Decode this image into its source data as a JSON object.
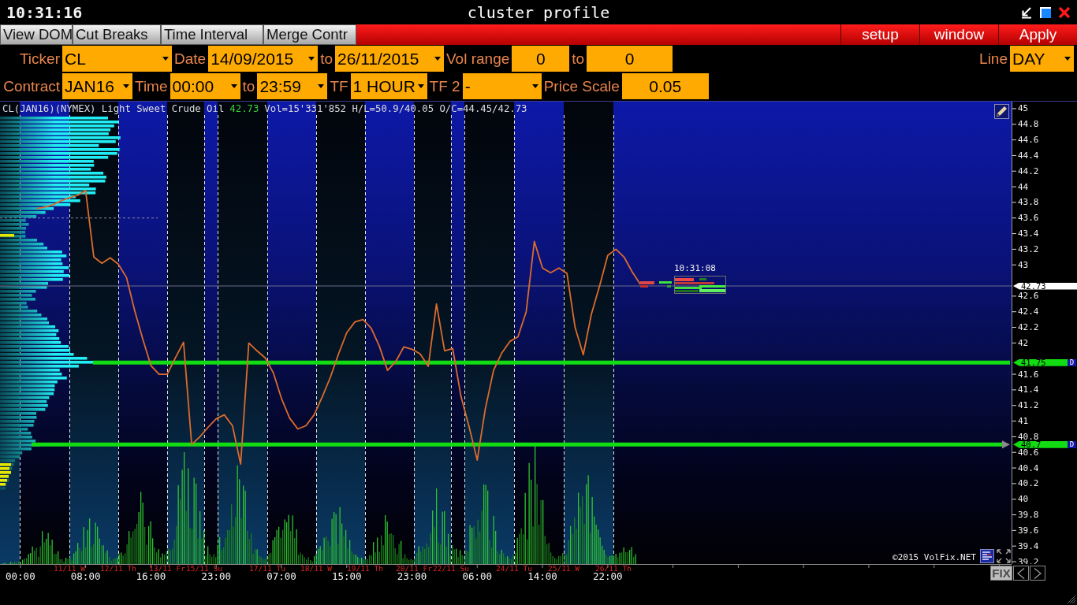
{
  "title_bar": {
    "clock": "10:31:16",
    "title": "cluster profile"
  },
  "toolbar": {
    "tools": [
      "View DOM",
      "Cut Breaks",
      "Time Interval",
      "Merge Contr"
    ],
    "menus": [
      "setup",
      "window",
      "Apply"
    ]
  },
  "parameters": [
    {
      "left": [
        {
          "label": "Ticker",
          "value": "CL",
          "kind": "dropdown"
        },
        {
          "label": "Date",
          "value": "14/09/2015",
          "kind": "dropdown"
        },
        {
          "label": "to",
          "value": "26/11/2015",
          "kind": "dropdown"
        },
        {
          "label": "Vol range",
          "value": "0",
          "kind": "number"
        },
        {
          "label": "to",
          "value": "0",
          "kind": "number"
        }
      ],
      "right": [
        {
          "label": "Line",
          "value": "DAY",
          "kind": "dropdown"
        }
      ]
    },
    {
      "left": [
        {
          "label": "Contract",
          "value": "JAN16",
          "kind": "dropdown"
        },
        {
          "label": "Time",
          "value": "00:00",
          "kind": "dropdown"
        },
        {
          "label": "to",
          "value": "23:59",
          "kind": "dropdown"
        },
        {
          "label": "TF",
          "value": "1 HOUR",
          "kind": "dropdown"
        },
        {
          "label": "TF 2",
          "value": "-",
          "kind": "dropdown"
        },
        {
          "label": "Price Scale",
          "value": "0.05",
          "kind": "number"
        }
      ]
    }
  ],
  "chart": {
    "header": {
      "instrument": "CL(JAN16)(NYMEX) Light Sweet Crude Oil",
      "last_price": "42.73",
      "stats": "Vol=15'331'852 H/L=50.9/40.05 O/C=44.45/42.73"
    },
    "chart_data": {
      "type": "line",
      "categories": [
        null,
        null,
        "00:00",
        null,
        null,
        null,
        null,
        null,
        null,
        null,
        "08:00",
        null,
        null,
        null,
        null,
        null,
        null,
        null,
        "16:00",
        null,
        null,
        null,
        null,
        null,
        null,
        null,
        "23:00",
        null,
        null,
        null,
        null,
        null,
        null,
        null,
        "07:00",
        null,
        null,
        null,
        null,
        null,
        null,
        null,
        "15:00",
        null,
        null,
        null,
        null,
        null,
        null,
        null,
        "23:00",
        null,
        null,
        null,
        null,
        null,
        null,
        null,
        "06:00",
        null,
        null,
        null,
        null,
        null,
        null,
        null,
        "14:00",
        null,
        null,
        null,
        null,
        null,
        null,
        null,
        "22:00",
        null,
        null,
        null,
        null,
        null,
        null,
        null,
        null,
        null,
        null,
        null,
        null,
        null,
        null,
        null,
        null,
        null,
        null,
        null,
        null,
        null,
        null,
        null,
        null,
        null,
        null,
        null,
        null,
        null,
        null,
        null,
        null,
        null,
        null,
        null,
        null,
        null,
        null,
        null,
        null,
        null,
        null,
        null,
        null,
        null,
        null,
        null,
        null,
        null
      ],
      "values": [
        null,
        null,
        null,
        null,
        43.72,
        43.74,
        43.77,
        43.82,
        43.86,
        43.89,
        43.95,
        43.1,
        43.02,
        43.09,
        43.01,
        42.84,
        42.42,
        42.05,
        41.71,
        41.6,
        41.6,
        41.81,
        42.01,
        40.7,
        40.8,
        40.92,
        41.03,
        41.08,
        40.94,
        40.45,
        42.0,
        41.9,
        41.81,
        41.62,
        41.29,
        41.04,
        40.9,
        40.94,
        41.08,
        41.31,
        41.56,
        41.86,
        42.13,
        42.27,
        42.3,
        42.19,
        41.96,
        41.65,
        41.76,
        41.95,
        41.92,
        41.86,
        41.7,
        42.5,
        41.9,
        41.93,
        41.32,
        40.93,
        40.5,
        41.16,
        41.65,
        41.87,
        42.02,
        42.08,
        42.4,
        43.3,
        42.96,
        42.9,
        42.96,
        42.89,
        42.2,
        41.85,
        42.37,
        42.73,
        43.12,
        43.2,
        43.1,
        42.91,
        42.75,
        null,
        null,
        null,
        null,
        null,
        null,
        null,
        null,
        null,
        null,
        null,
        null,
        null,
        null,
        null,
        null,
        null,
        null,
        null,
        null,
        null,
        null,
        null,
        null,
        null,
        null,
        null,
        null,
        null,
        null,
        null,
        null,
        null,
        null,
        null,
        null,
        null,
        null,
        null,
        null,
        null,
        null,
        null,
        null,
        null
      ],
      "ylim": [
        39.17,
        45.09
      ],
      "yticks": [
        45,
        44.8,
        44.6,
        44.4,
        44.2,
        44,
        43.8,
        43.6,
        43.4,
        43.2,
        43,
        42.6,
        42.4,
        42.2,
        42,
        41.6,
        41.4,
        41.2,
        41,
        40.8,
        40.6,
        40.4,
        40.2,
        40,
        39.8,
        39.6,
        39.4,
        39.2
      ],
      "grid": true,
      "ref_lines": [
        {
          "axis": "y",
          "value": 42.73,
          "label": "42.73",
          "color": "#6c6c8c"
        },
        {
          "axis": "y",
          "value": 41.75,
          "label": "41.75",
          "color": "#12dc12"
        },
        {
          "axis": "y",
          "value": 40.7,
          "label": "40.7",
          "color": "#12dc12"
        },
        {
          "axis": "y",
          "value": 43.6,
          "color": "#8a8aa8"
        }
      ]
    },
    "axis_markers": [
      {
        "kind": "last"
      },
      {
        "kind": "level",
        "tag": "D"
      },
      {
        "kind": "level",
        "tag": "D"
      }
    ],
    "cluster_time": "10:31:08",
    "copyright": "©2015 VolFix.NET",
    "dates": [
      "11/11 W",
      "12/11 Th",
      "13/11 Fr",
      "15/11 Su",
      "17/11 Tu",
      "18/11 W",
      "19/11 Th",
      "20/11 Fr",
      "22/11 Su",
      "24/11 Tu",
      "25/11 W",
      "26/11 Th"
    ],
    "fix_button": "FIX"
  }
}
